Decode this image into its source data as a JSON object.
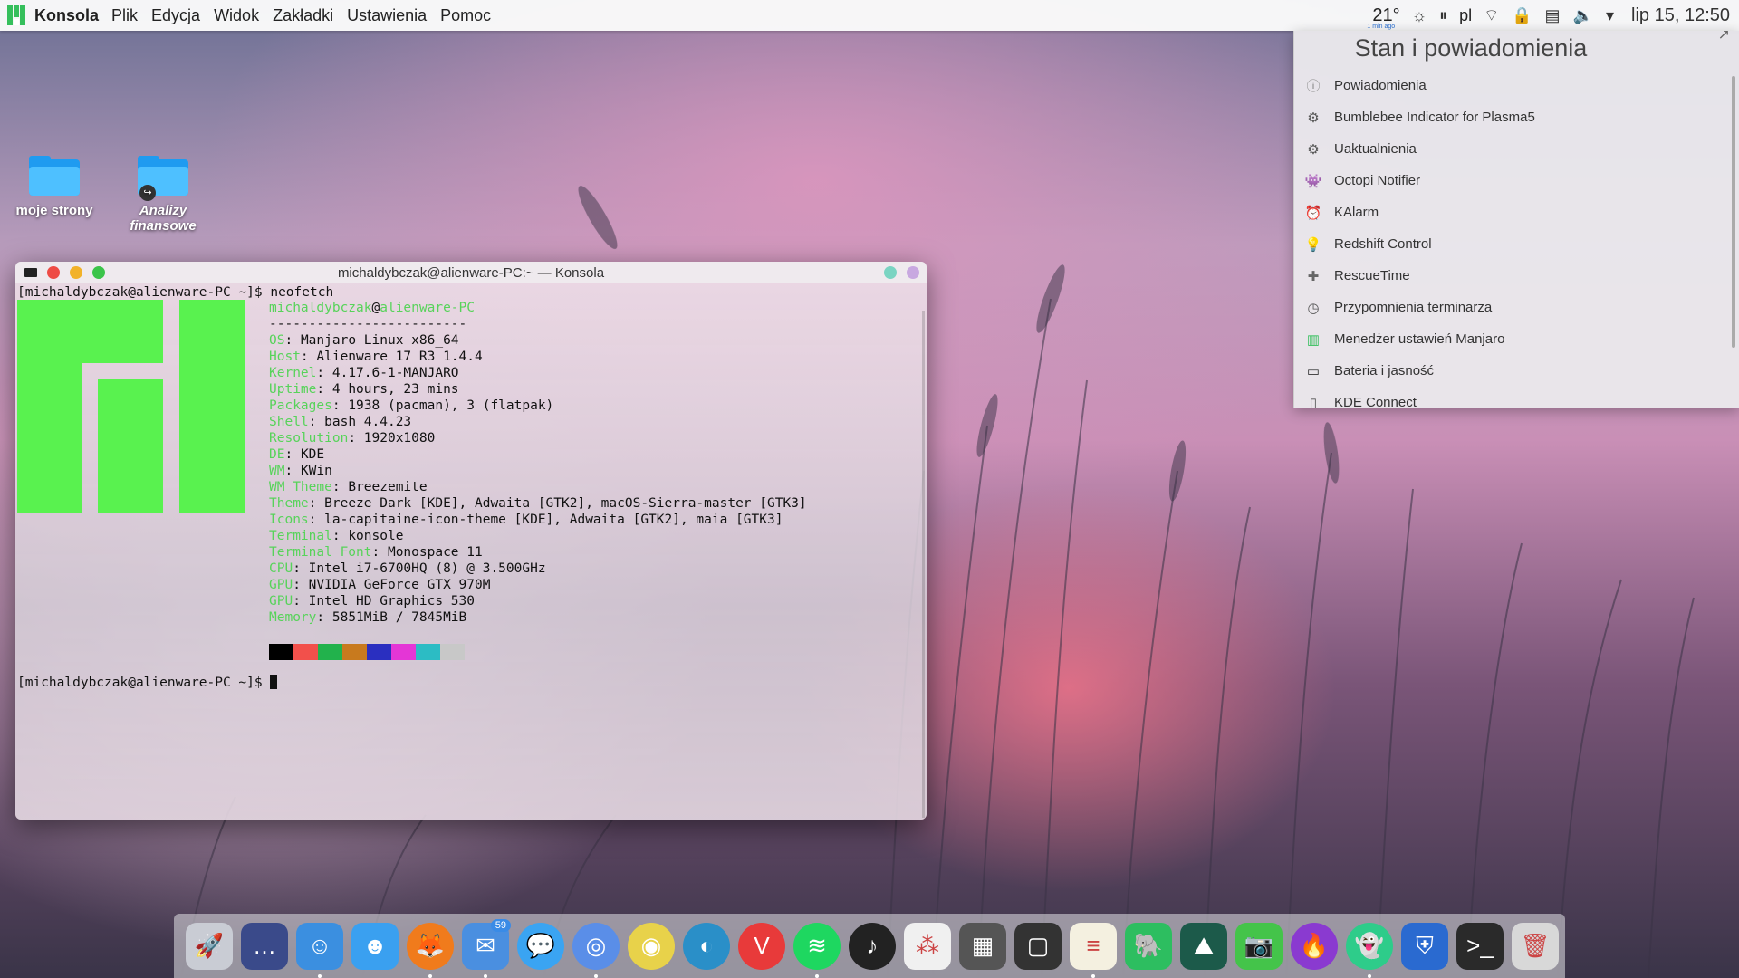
{
  "menubar": {
    "app_name": "Konsola",
    "menu_items": [
      "Plik",
      "Edycja",
      "Widok",
      "Zakładki",
      "Ustawienia",
      "Pomoc"
    ],
    "weather_temp": "21°",
    "weather_sub": "1 min ago",
    "language": "pl",
    "clock": "lip 15, 12:50"
  },
  "desktop": {
    "icons": [
      {
        "label": "moje strony"
      },
      {
        "label": "Analizy finansowe"
      }
    ]
  },
  "terminal": {
    "title": "michaldybczak@alienware-PC:~ — Konsola",
    "prompt1": "[michaldybczak@alienware-PC ~]$ neofetch",
    "prompt2": "[michaldybczak@alienware-PC ~]$ ",
    "user_host_user": "michaldybczak",
    "user_host_at": "@",
    "user_host_host": "alienware-PC",
    "separator": "-------------------------",
    "info": [
      {
        "key": "OS",
        "value": "Manjaro Linux x86_64"
      },
      {
        "key": "Host",
        "value": "Alienware 17 R3 1.4.4"
      },
      {
        "key": "Kernel",
        "value": "4.17.6-1-MANJARO"
      },
      {
        "key": "Uptime",
        "value": "4 hours, 23 mins"
      },
      {
        "key": "Packages",
        "value": "1938 (pacman), 3 (flatpak)"
      },
      {
        "key": "Shell",
        "value": "bash 4.4.23"
      },
      {
        "key": "Resolution",
        "value": "1920x1080"
      },
      {
        "key": "DE",
        "value": "KDE"
      },
      {
        "key": "WM",
        "value": "KWin"
      },
      {
        "key": "WM Theme",
        "value": "Breezemite"
      },
      {
        "key": "Theme",
        "value": "Breeze Dark [KDE], Adwaita [GTK2], macOS-Sierra-master [GTK3]"
      },
      {
        "key": "Icons",
        "value": "la-capitaine-icon-theme [KDE], Adwaita [GTK2], maia [GTK3]"
      },
      {
        "key": "Terminal",
        "value": "konsole"
      },
      {
        "key": "Terminal Font",
        "value": "Monospace 11"
      },
      {
        "key": "CPU",
        "value": "Intel i7-6700HQ (8) @ 3.500GHz"
      },
      {
        "key": "GPU",
        "value": "NVIDIA GeForce GTX 970M"
      },
      {
        "key": "GPU",
        "value": "Intel HD Graphics 530"
      },
      {
        "key": "Memory",
        "value": "5851MiB / 7845MiB"
      }
    ],
    "colors": [
      "#000000",
      "#f2504b",
      "#22b24c",
      "#c87a1e",
      "#2a2fc0",
      "#e436d6",
      "#2cbcc4",
      "#c8c8c8"
    ],
    "logo_color": "#59f24f"
  },
  "panel": {
    "title": "Stan i powiadomienia",
    "items": [
      {
        "label": "Powiadomienia",
        "icon": "info-icon"
      },
      {
        "label": "Bumblebee Indicator for Plasma5",
        "icon": "bumblebee-icon"
      },
      {
        "label": "Uaktualnienia",
        "icon": "gear-icon"
      },
      {
        "label": "Octopi Notifier",
        "icon": "octopi-icon"
      },
      {
        "label": "KAlarm",
        "icon": "alarm-icon"
      },
      {
        "label": "Redshift Control",
        "icon": "bulb-icon"
      },
      {
        "label": "RescueTime",
        "icon": "rescuetime-icon"
      },
      {
        "label": "Przypomnienia terminarza",
        "icon": "clock-icon"
      },
      {
        "label": "Menedżer ustawień Manjaro",
        "icon": "manjaro-icon"
      },
      {
        "label": "Bateria i jasność",
        "icon": "battery-icon"
      },
      {
        "label": "KDE Connect",
        "icon": "kdeconnect-icon"
      }
    ]
  },
  "dock": {
    "items": [
      {
        "name": "launchpad-icon",
        "bg": "#c9ccd4",
        "glyph": "🚀"
      },
      {
        "name": "terminal-dots-icon",
        "bg": "#3a4a8a",
        "glyph": "…"
      },
      {
        "name": "finder-icon",
        "bg": "#3b8fe0",
        "glyph": "☺"
      },
      {
        "name": "finder2-icon",
        "bg": "#3aa0f0",
        "glyph": "☻"
      },
      {
        "name": "firefox-icon",
        "bg": "#f07b1c",
        "glyph": "🦊"
      },
      {
        "name": "mail-icon",
        "bg": "#4a8fe0",
        "glyph": "✉",
        "badge": "59"
      },
      {
        "name": "messages-icon",
        "bg": "#3aa4f2",
        "glyph": "💬"
      },
      {
        "name": "chromium-icon",
        "bg": "#5a8ee8",
        "glyph": "◎"
      },
      {
        "name": "chrome-icon",
        "bg": "#e8d24a",
        "glyph": "◉"
      },
      {
        "name": "wave-browser-icon",
        "bg": "#2a8fc8",
        "glyph": "◐"
      },
      {
        "name": "vivaldi-icon",
        "bg": "#e83a3a",
        "glyph": "V"
      },
      {
        "name": "spotify-icon",
        "bg": "#1ed760",
        "glyph": "≋"
      },
      {
        "name": "music-icon",
        "bg": "#222222",
        "glyph": "♪"
      },
      {
        "name": "asana-icon",
        "bg": "#f0f0f0",
        "glyph": "⁂"
      },
      {
        "name": "calculator-icon",
        "bg": "#555555",
        "glyph": "▦"
      },
      {
        "name": "notes-dark-icon",
        "bg": "#333333",
        "glyph": "▢"
      },
      {
        "name": "text-editor-icon",
        "bg": "#f4f0e0",
        "glyph": "≡"
      },
      {
        "name": "evernote-icon",
        "bg": "#2dbe60",
        "glyph": "🐘"
      },
      {
        "name": "system-monitor-icon",
        "bg": "#1c5a4a",
        "glyph": "⛰"
      },
      {
        "name": "screenshot-icon",
        "bg": "#44c44a",
        "glyph": "📷"
      },
      {
        "name": "flame-icon",
        "bg": "#8a3ad0",
        "glyph": "🔥"
      },
      {
        "name": "ghost-icon",
        "bg": "#2ecc8a",
        "glyph": "👻"
      },
      {
        "name": "shield-icon",
        "bg": "#2a6ad0",
        "glyph": "⛨"
      },
      {
        "name": "terminal-icon",
        "bg": "#2a2a2a",
        "glyph": ">_"
      },
      {
        "name": "trash-icon",
        "bg": "#d8d8d8",
        "glyph": "🗑"
      }
    ]
  }
}
